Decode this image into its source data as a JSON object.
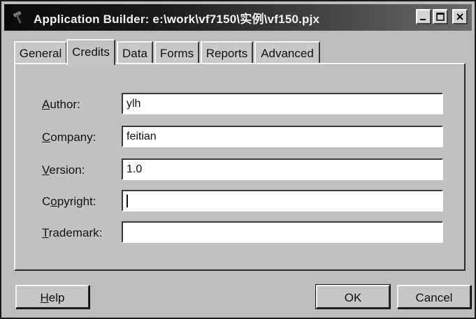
{
  "window": {
    "title": "Application Builder: e:\\work\\vf7150\\实例\\vf150.pjx",
    "icon": "hammer-icon",
    "controls": [
      "minimize-icon",
      "maximize-icon",
      "close-icon"
    ]
  },
  "tabs": [
    {
      "label": "General",
      "active": false
    },
    {
      "label": "Credits",
      "active": true
    },
    {
      "label": "Data",
      "active": false
    },
    {
      "label": "Forms",
      "active": false
    },
    {
      "label": "Reports",
      "active": false
    },
    {
      "label": "Advanced",
      "active": false
    }
  ],
  "fields": [
    {
      "label_acc": "A",
      "label_rest": "uthor:",
      "value": "ylh"
    },
    {
      "label_acc": "C",
      "label_rest": "ompany:",
      "value": "feitian"
    },
    {
      "label_acc": "V",
      "label_rest": "ersion:",
      "value": "1.0"
    },
    {
      "label_pre": "C",
      "label_acc": "o",
      "label_rest": "pyright:",
      "value": ""
    },
    {
      "label_acc": "T",
      "label_rest": "rademark:",
      "value": ""
    }
  ],
  "buttons": {
    "help_acc": "H",
    "help_rest": "elp",
    "ok": "OK",
    "cancel": "Cancel"
  },
  "colors": {
    "titlebar_start": "#0a0a0a",
    "face": "#c1c1c1"
  }
}
